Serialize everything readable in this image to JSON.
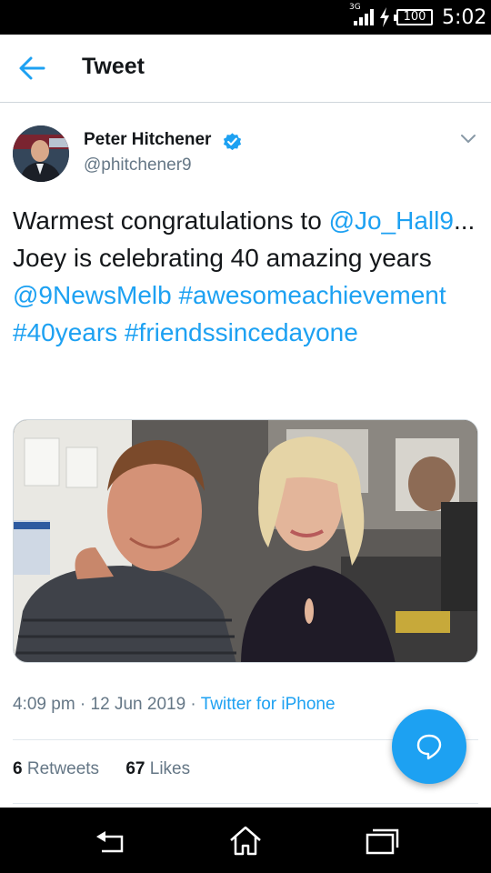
{
  "status_bar": {
    "network": "3G",
    "battery": "100",
    "time": "5:02"
  },
  "header": {
    "title": "Tweet",
    "back_icon": "arrow-left-icon"
  },
  "tweet": {
    "author": {
      "name": "Peter Hitchener",
      "handle": "@phitchener9",
      "verified_icon": "verified-badge-icon"
    },
    "text": {
      "t1": "Warmest congratulations to ",
      "mention1": "@Jo_Hall9",
      "t2": "... Joey is celebrating 40 amazing years ",
      "mention2": "@9NewsMelb",
      "hashtag1": "#awesomeachievement",
      "hashtag2": "#40years",
      "hashtag3": "#friendssincedayone"
    },
    "meta": {
      "time": "4:09 pm",
      "sep1": " · ",
      "date": "12 Jun 2019",
      "sep2": " · ",
      "source": "Twitter for iPhone"
    },
    "stats": {
      "retweets_count": "6",
      "retweets_label": "Retweets",
      "likes_count": "67",
      "likes_label": "Likes"
    }
  },
  "fab": {
    "icon": "reply-bubble-icon"
  },
  "colors": {
    "link": "#1da1f2",
    "text": "#14171a",
    "secondary": "#657786",
    "fab": "#1da1f2"
  },
  "nav_bar": {
    "icons": [
      "back-nav-icon",
      "home-nav-icon",
      "recents-nav-icon"
    ]
  }
}
